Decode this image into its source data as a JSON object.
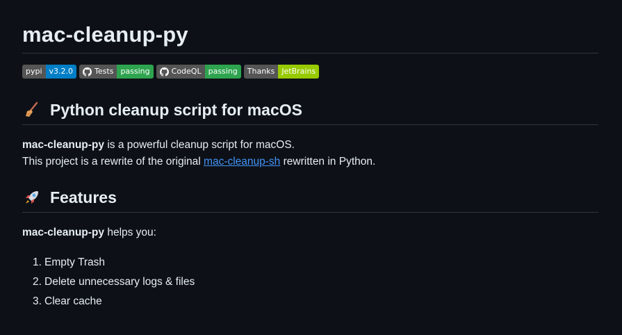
{
  "title": "mac-cleanup-py",
  "badges": [
    {
      "left": "pypi",
      "right": "v3.2.0",
      "right_color": "#007ec6",
      "icon": "",
      "width_left": 32,
      "width_right": 46
    },
    {
      "left": "Tests",
      "right": "passing",
      "right_color": "#2ea44f",
      "icon": "github-icon"
    },
    {
      "left": "CodeQL",
      "right": "passing",
      "right_color": "#2ea44f",
      "icon": "github-icon"
    },
    {
      "left": "Thanks",
      "right": "JetBrains",
      "right_color": "#97ca00",
      "icon": ""
    }
  ],
  "section1": {
    "emoji": "broom-icon",
    "heading": "Python cleanup script for macOS",
    "line1_bold": "mac-cleanup-py",
    "line1_rest": " is a powerful cleanup script for macOS.",
    "line2_pre": "This project is a rewrite of the original ",
    "line2_link": "mac-cleanup-sh",
    "line2_post": " rewritten in Python."
  },
  "section2": {
    "emoji": "rocket-icon",
    "heading": "Features",
    "intro_bold": "mac-cleanup-py",
    "intro_rest": " helps you:",
    "items": [
      {
        "num": "1.",
        "text": "Empty Trash"
      },
      {
        "num": "2.",
        "text": "Delete unnecessary logs & files"
      },
      {
        "num": "3.",
        "text": "Clear cache"
      }
    ]
  },
  "colors": {
    "background": "#0d1117",
    "text": "#e6edf3",
    "link": "#4493f8",
    "rule": "#30363d",
    "badge_left": "#555555"
  }
}
